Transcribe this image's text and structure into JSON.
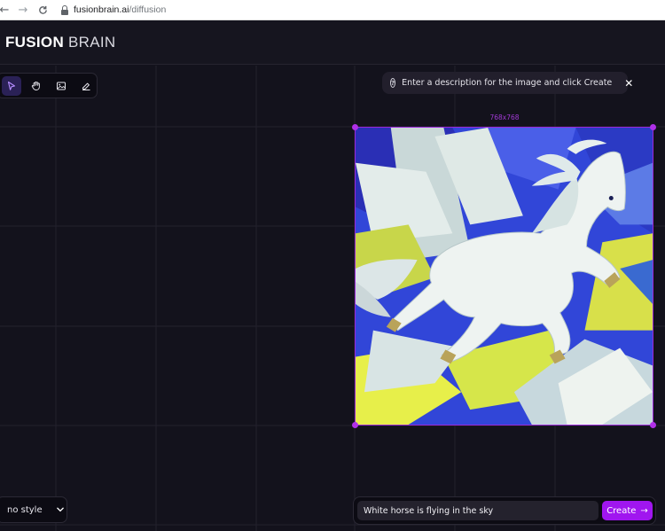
{
  "browser": {
    "url_host": "fusionbrain.ai",
    "url_path": "/diffusion"
  },
  "header": {
    "logo_bold": "FUSION",
    "logo_light": "BRAIN"
  },
  "toolbar": {
    "tools": [
      "select-tool",
      "hand-tool",
      "image-tool",
      "eraser-tool"
    ],
    "active": "select-tool"
  },
  "hint": {
    "icon": "question-circle-icon",
    "text": "Enter a description for the image and click Create"
  },
  "image": {
    "size_label": "768x768",
    "description": ""
  },
  "style_select": {
    "value": "no style"
  },
  "prompt": {
    "value": "White horse is flying in the sky"
  },
  "create_button": {
    "label": "Create"
  },
  "colors": {
    "background": "#13121c",
    "accent": "#a016ef",
    "handle": "#b030e8"
  }
}
